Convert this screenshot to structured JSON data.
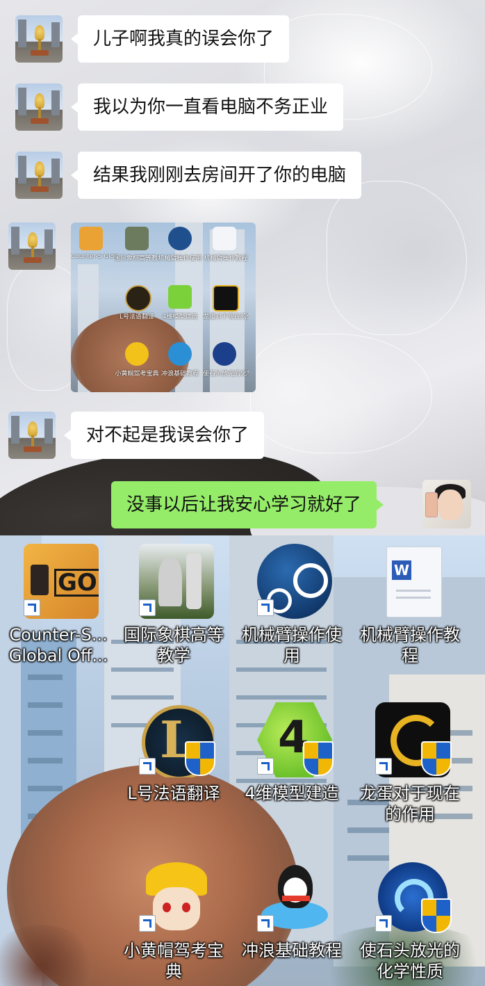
{
  "chat": {
    "messages": [
      {
        "side": "left",
        "text": "儿子啊我真的误会你了"
      },
      {
        "side": "left",
        "text": "我以为你一直看电脑不务正业"
      },
      {
        "side": "left",
        "text": "结果我刚刚去房间开了你的电脑"
      },
      {
        "side": "left",
        "type": "image"
      },
      {
        "side": "left",
        "text": "对不起是我误会你了"
      },
      {
        "side": "right",
        "text": "没事以后让我安心学习就好了"
      }
    ]
  },
  "thumbnail_labels": [
    "Counter-S Global Off...",
    "国际象棋高等教学",
    "机械臂操作使用",
    "机械臂操作教程",
    "L号法语翻译",
    "4维模型建造",
    "龙蛋对于现在的作用",
    "小黄帽驾考宝典",
    "冲浪基础教程",
    "使石头放光的化学性质"
  ],
  "desktop": {
    "icons": [
      {
        "label": "Counter-S... Global Off...",
        "icon": "csgo-icon"
      },
      {
        "label": "国际象棋高等教学",
        "icon": "chess-icon"
      },
      {
        "label": "机械臂操作使用",
        "icon": "steam-icon"
      },
      {
        "label": "机械臂操作教程",
        "icon": "word-document-icon"
      },
      {
        "label": "L号法语翻译",
        "icon": "league-of-legends-icon"
      },
      {
        "label": "4维模型建造",
        "icon": "green-4-icon"
      },
      {
        "label": "龙蛋对于现在的作用",
        "icon": "dragon-game-icon"
      },
      {
        "label": "小黄帽驾考宝典",
        "icon": "yellow-hat-girl-icon"
      },
      {
        "label": "冲浪基础教程",
        "icon": "qq-penguin-icon"
      },
      {
        "label": "使石头放光的化学性质",
        "icon": "blue-swirl-icon"
      }
    ]
  },
  "colors": {
    "bubble_left": "#ffffff",
    "bubble_right": "#95ec69"
  }
}
